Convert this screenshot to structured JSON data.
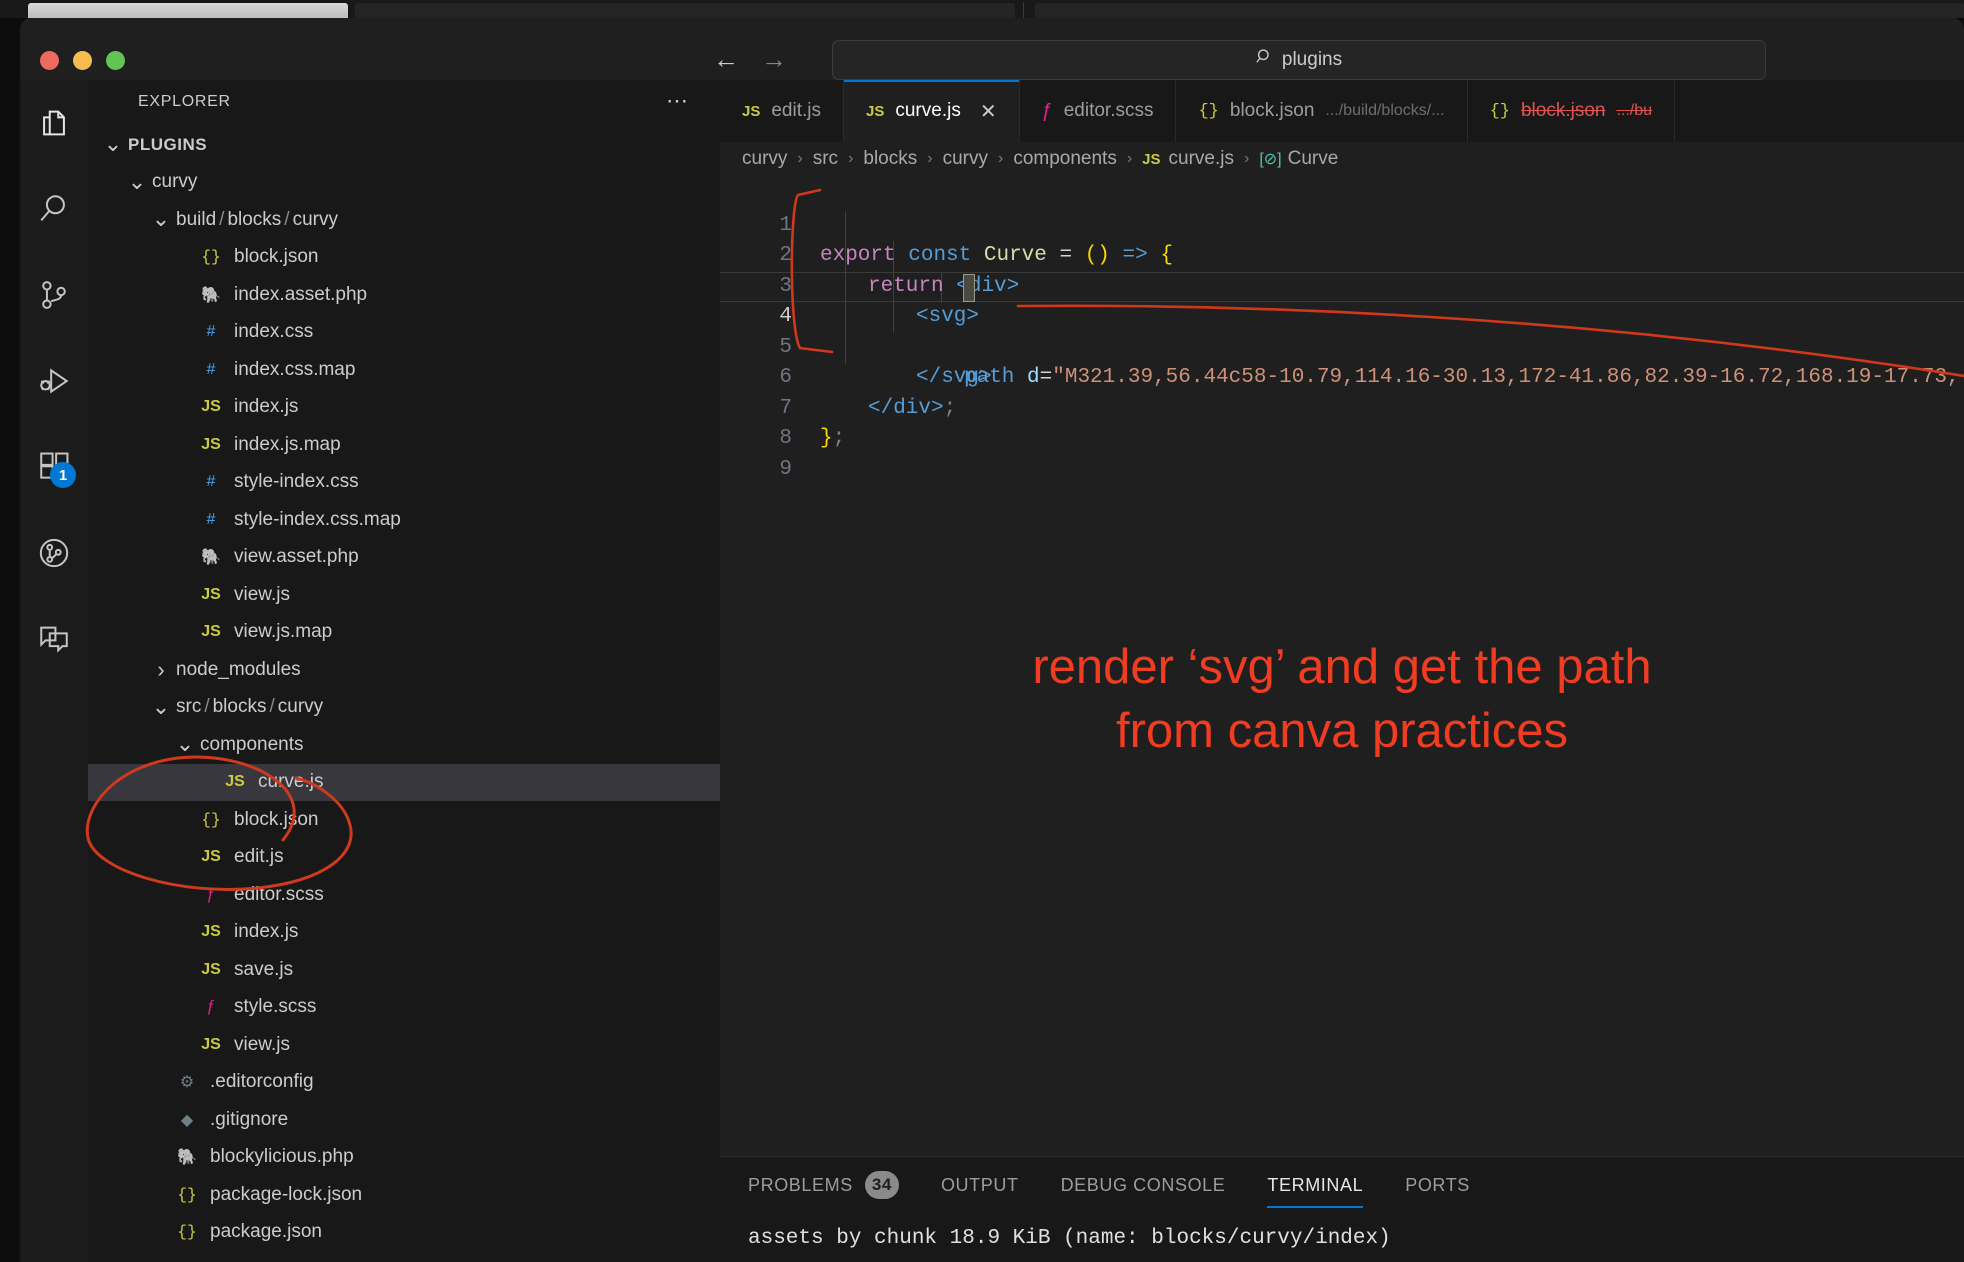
{
  "window": {
    "traffic_lights": [
      "close",
      "minimize",
      "maximize"
    ],
    "colors": {
      "close": "#ed6a5f",
      "minimize": "#f5bd4f",
      "maximize": "#61c454",
      "accent": "#0078d4",
      "annotation": "#f03c20"
    }
  },
  "titlebar": {
    "back_icon": "arrow-left-icon",
    "forward_icon": "arrow-right-icon",
    "command_center": {
      "search_icon": "search-icon",
      "value": "plugins"
    }
  },
  "activity_bar": {
    "items": [
      {
        "name": "explorer",
        "icon": "files-icon",
        "badge": null
      },
      {
        "name": "search",
        "icon": "search-icon",
        "badge": null
      },
      {
        "name": "source-control",
        "icon": "source-control-icon",
        "badge": null
      },
      {
        "name": "run-and-debug",
        "icon": "run-debug-icon",
        "badge": null
      },
      {
        "name": "extensions",
        "icon": "extensions-icon",
        "badge": "1"
      },
      {
        "name": "testing",
        "icon": "testing-icon",
        "badge": null
      },
      {
        "name": "chat",
        "icon": "chat-icon",
        "badge": null
      }
    ]
  },
  "sidebar": {
    "title": "EXPLORER",
    "actions_icon": "ellipsis-icon",
    "tree": [
      {
        "indent": 0,
        "chevron": "down",
        "label": "PLUGINS",
        "icon": null,
        "section": true,
        "selected": false
      },
      {
        "indent": 1,
        "chevron": "down",
        "label": "curvy",
        "icon": null,
        "section": false,
        "selected": false
      },
      {
        "indent": 2,
        "chevron": "down",
        "label": "build/blocks/curvy",
        "icon": null,
        "section": false,
        "selected": false
      },
      {
        "indent": 3,
        "chevron": null,
        "label": "block.json",
        "icon": "json-icon",
        "section": false,
        "selected": false
      },
      {
        "indent": 3,
        "chevron": null,
        "label": "index.asset.php",
        "icon": "php-icon",
        "section": false,
        "selected": false
      },
      {
        "indent": 3,
        "chevron": null,
        "label": "index.css",
        "icon": "css-icon",
        "section": false,
        "selected": false
      },
      {
        "indent": 3,
        "chevron": null,
        "label": "index.css.map",
        "icon": "css-icon",
        "section": false,
        "selected": false
      },
      {
        "indent": 3,
        "chevron": null,
        "label": "index.js",
        "icon": "js-icon",
        "section": false,
        "selected": false
      },
      {
        "indent": 3,
        "chevron": null,
        "label": "index.js.map",
        "icon": "js-icon",
        "section": false,
        "selected": false
      },
      {
        "indent": 3,
        "chevron": null,
        "label": "style-index.css",
        "icon": "css-icon",
        "section": false,
        "selected": false
      },
      {
        "indent": 3,
        "chevron": null,
        "label": "style-index.css.map",
        "icon": "css-icon",
        "section": false,
        "selected": false
      },
      {
        "indent": 3,
        "chevron": null,
        "label": "view.asset.php",
        "icon": "php-icon",
        "section": false,
        "selected": false
      },
      {
        "indent": 3,
        "chevron": null,
        "label": "view.js",
        "icon": "js-icon",
        "section": false,
        "selected": false
      },
      {
        "indent": 3,
        "chevron": null,
        "label": "view.js.map",
        "icon": "js-icon",
        "section": false,
        "selected": false
      },
      {
        "indent": 2,
        "chevron": "right",
        "label": "node_modules",
        "icon": null,
        "section": false,
        "selected": false
      },
      {
        "indent": 2,
        "chevron": "down",
        "label": "src/blocks/curvy",
        "icon": null,
        "section": false,
        "selected": false
      },
      {
        "indent": 3,
        "chevron": "down",
        "label": "components",
        "icon": null,
        "section": false,
        "selected": false
      },
      {
        "indent": 4,
        "chevron": null,
        "label": "curve.js",
        "icon": "js-icon",
        "section": false,
        "selected": true
      },
      {
        "indent": 3,
        "chevron": null,
        "label": "block.json",
        "icon": "json-icon",
        "section": false,
        "selected": false
      },
      {
        "indent": 3,
        "chevron": null,
        "label": "edit.js",
        "icon": "js-icon",
        "section": false,
        "selected": false
      },
      {
        "indent": 3,
        "chevron": null,
        "label": "editor.scss",
        "icon": "scss-icon",
        "section": false,
        "selected": false
      },
      {
        "indent": 3,
        "chevron": null,
        "label": "index.js",
        "icon": "js-icon",
        "section": false,
        "selected": false
      },
      {
        "indent": 3,
        "chevron": null,
        "label": "save.js",
        "icon": "js-icon",
        "section": false,
        "selected": false
      },
      {
        "indent": 3,
        "chevron": null,
        "label": "style.scss",
        "icon": "scss-icon",
        "section": false,
        "selected": false
      },
      {
        "indent": 3,
        "chevron": null,
        "label": "view.js",
        "icon": "js-icon",
        "section": false,
        "selected": false
      },
      {
        "indent": 2,
        "chevron": null,
        "label": ".editorconfig",
        "icon": "gear-icon",
        "section": false,
        "selected": false
      },
      {
        "indent": 2,
        "chevron": null,
        "label": ".gitignore",
        "icon": "git-icon",
        "section": false,
        "selected": false
      },
      {
        "indent": 2,
        "chevron": null,
        "label": "blockylicious.php",
        "icon": "php-icon",
        "section": false,
        "selected": false
      },
      {
        "indent": 2,
        "chevron": null,
        "label": "package-lock.json",
        "icon": "json-icon",
        "section": false,
        "selected": false
      },
      {
        "indent": 2,
        "chevron": null,
        "label": "package.json",
        "icon": "json-icon",
        "section": false,
        "selected": false
      }
    ]
  },
  "editor": {
    "tabs": [
      {
        "label": "edit.js",
        "desc": "",
        "icon": "js-icon",
        "active": false,
        "deleted": false,
        "closable": false
      },
      {
        "label": "curve.js",
        "desc": "",
        "icon": "js-icon",
        "active": true,
        "deleted": false,
        "closable": true
      },
      {
        "label": "editor.scss",
        "desc": "",
        "icon": "scss-icon",
        "active": false,
        "deleted": false,
        "closable": false
      },
      {
        "label": "block.json",
        "desc": ".../build/blocks/...",
        "icon": "json-icon",
        "active": false,
        "deleted": false,
        "closable": false
      },
      {
        "label": "block.json",
        "desc": ".../bu",
        "icon": "json-icon",
        "active": false,
        "deleted": true,
        "closable": false
      }
    ],
    "close_icon": "close-icon",
    "breadcrumbs": [
      {
        "label": "curvy",
        "icon": null
      },
      {
        "label": "src",
        "icon": null
      },
      {
        "label": "blocks",
        "icon": null
      },
      {
        "label": "curvy",
        "icon": null
      },
      {
        "label": "components",
        "icon": null
      },
      {
        "label": "curve.js",
        "icon": "js-icon"
      },
      {
        "label": "Curve",
        "icon": "symbol-constant-icon"
      }
    ],
    "lines": [
      {
        "no": "1",
        "current": false
      },
      {
        "no": "2",
        "current": false
      },
      {
        "no": "3",
        "current": false
      },
      {
        "no": "4",
        "current": true
      },
      {
        "no": "5",
        "current": false
      },
      {
        "no": "6",
        "current": false
      },
      {
        "no": "7",
        "current": false
      },
      {
        "no": "8",
        "current": false
      },
      {
        "no": "9",
        "current": false
      }
    ],
    "code": {
      "l1_export": "export",
      "l1_const": "const",
      "l1_name": "Curve",
      "l1_eq": "=",
      "l1_parens": "()",
      "l1_arrow": "=>",
      "l1_brace": "{",
      "l2_return": "return",
      "l2_tag": "<div>",
      "l3_tag": "<svg>",
      "l4_lt": "<",
      "l4_tag": "path",
      "l4_attr": "d",
      "l4_eq": "=",
      "l4_value": "\"M321.39,56.44c58-10.79,114.16-30.13,172-41.86,82.39-16.72,168.19-17.73,",
      "l5_tag": "</svg>",
      "l6_tag": "</div>",
      "l6_semi": ";",
      "l7_brace": "}",
      "l7_semi": ";"
    },
    "annotation_line1": "render ‘svg’ and get the path",
    "annotation_line2": "from canva practices"
  },
  "panel": {
    "tabs": [
      {
        "label": "PROBLEMS",
        "badge": "34",
        "active": false
      },
      {
        "label": "OUTPUT",
        "badge": null,
        "active": false
      },
      {
        "label": "DEBUG CONSOLE",
        "badge": null,
        "active": false
      },
      {
        "label": "TERMINAL",
        "badge": null,
        "active": true
      },
      {
        "label": "PORTS",
        "badge": null,
        "active": false
      }
    ],
    "terminal_line": "assets by chunk 18.9 KiB (name: blocks/curvy/index)"
  }
}
